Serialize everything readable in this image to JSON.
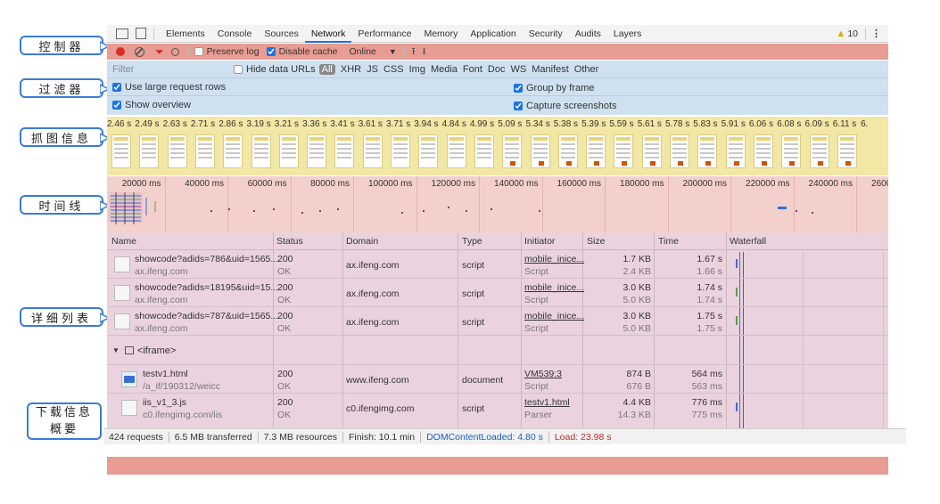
{
  "callouts": {
    "controls": "控制器",
    "filter": "过滤器",
    "screenshots": "抓图信息",
    "timeline": "时间线",
    "list": "详细列表",
    "summary_line1": "下载信息",
    "summary_line2": "概要"
  },
  "tabs": [
    "Elements",
    "Console",
    "Sources",
    "Network",
    "Performance",
    "Memory",
    "Application",
    "Security",
    "Audits",
    "Layers"
  ],
  "active_tab": "Network",
  "warnings": "10",
  "controls": {
    "preserve_log": "Preserve log",
    "disable_cache": "Disable cache",
    "throttle": "Online"
  },
  "filter": {
    "placeholder": "Filter",
    "hide_data_urls": "Hide data URLs",
    "types": [
      "All",
      "XHR",
      "JS",
      "CSS",
      "Img",
      "Media",
      "Font",
      "Doc",
      "WS",
      "Manifest",
      "Other"
    ],
    "large_rows": "Use large request rows",
    "group_by_frame": "Group by frame",
    "show_overview": "Show overview",
    "capture_screenshots": "Capture screenshots"
  },
  "screenshot_times": [
    "2.46 s",
    "2.49 s",
    "2.63 s",
    "2.71 s",
    "2.86 s",
    "3.19 s",
    "3.21 s",
    "3.36 s",
    "3.41 s",
    "3.61 s",
    "3.71 s",
    "3.94 s",
    "4.84 s",
    "4.99 s",
    "5.09 s",
    "5.34 s",
    "5.38 s",
    "5.39 s",
    "5.59 s",
    "5.61 s",
    "5.78 s",
    "5.83 s",
    "5.91 s",
    "6.06 s",
    "6.08 s",
    "6.09 s",
    "6.11 s",
    "6."
  ],
  "timeline_ticks": [
    "20000 ms",
    "40000 ms",
    "60000 ms",
    "80000 ms",
    "100000 ms",
    "120000 ms",
    "140000 ms",
    "160000 ms",
    "180000 ms",
    "200000 ms",
    "220000 ms",
    "240000 ms",
    "260000 ms"
  ],
  "columns": [
    "Name",
    "Status",
    "Domain",
    "Type",
    "Initiator",
    "Size",
    "Time",
    "Waterfall"
  ],
  "rows": [
    {
      "name": "showcode?adids=786&uid=1565...",
      "path": "ax.ifeng.com",
      "status": "200",
      "status_text": "OK",
      "domain": "ax.ifeng.com",
      "type": "script",
      "initiator": "mobile_inice...",
      "initiator_type": "Script",
      "size": "1.7 KB",
      "size2": "2.4 KB",
      "time": "1.67 s",
      "time2": "1.66 s"
    },
    {
      "name": "showcode?adids=18195&uid=15...",
      "path": "ax.ifeng.com",
      "status": "200",
      "status_text": "OK",
      "domain": "ax.ifeng.com",
      "type": "script",
      "initiator": "mobile_inice...",
      "initiator_type": "Script",
      "size": "3.0 KB",
      "size2": "5.0 KB",
      "time": "1.74 s",
      "time2": "1.74 s"
    },
    {
      "name": "showcode?adids=787&uid=1565...",
      "path": "ax.ifeng.com",
      "status": "200",
      "status_text": "OK",
      "domain": "ax.ifeng.com",
      "type": "script",
      "initiator": "mobile_inice...",
      "initiator_type": "Script",
      "size": "3.0 KB",
      "size2": "5.0 KB",
      "time": "1.75 s",
      "time2": "1.75 s"
    },
    {
      "name": "testv1.html",
      "path": "/a_if/190312/weicc",
      "status": "200",
      "status_text": "OK",
      "domain": "www.ifeng.com",
      "type": "document",
      "initiator": "VM539:3",
      "initiator_type": "Script",
      "size": "874 B",
      "size2": "676 B",
      "time": "564 ms",
      "time2": "563 ms"
    },
    {
      "name": "iis_v1_3.js",
      "path": "c0.ifengimg.com/iis",
      "status": "200",
      "status_text": "OK",
      "domain": "c0.ifengimg.com",
      "type": "script",
      "initiator": "testv1.html",
      "initiator_type": "Parser",
      "size": "4.4 KB",
      "size2": "14.3 KB",
      "time": "776 ms",
      "time2": "775 ms"
    }
  ],
  "group_label": "<iframe>",
  "summary": {
    "requests": "424 requests",
    "transferred": "6.5 MB transferred",
    "resources": "7.3 MB resources",
    "finish": "Finish: 10.1 min",
    "dcl": "DOMContentLoaded: 4.80 s",
    "load": "Load: 23.98 s"
  },
  "colors": {
    "controls_bg": "#e89c94",
    "filter_bg": "#cfe1f0",
    "screens_bg": "#f3e7a5",
    "timeline_bg": "#f3d0cb",
    "list_bg": "#ead3df"
  }
}
